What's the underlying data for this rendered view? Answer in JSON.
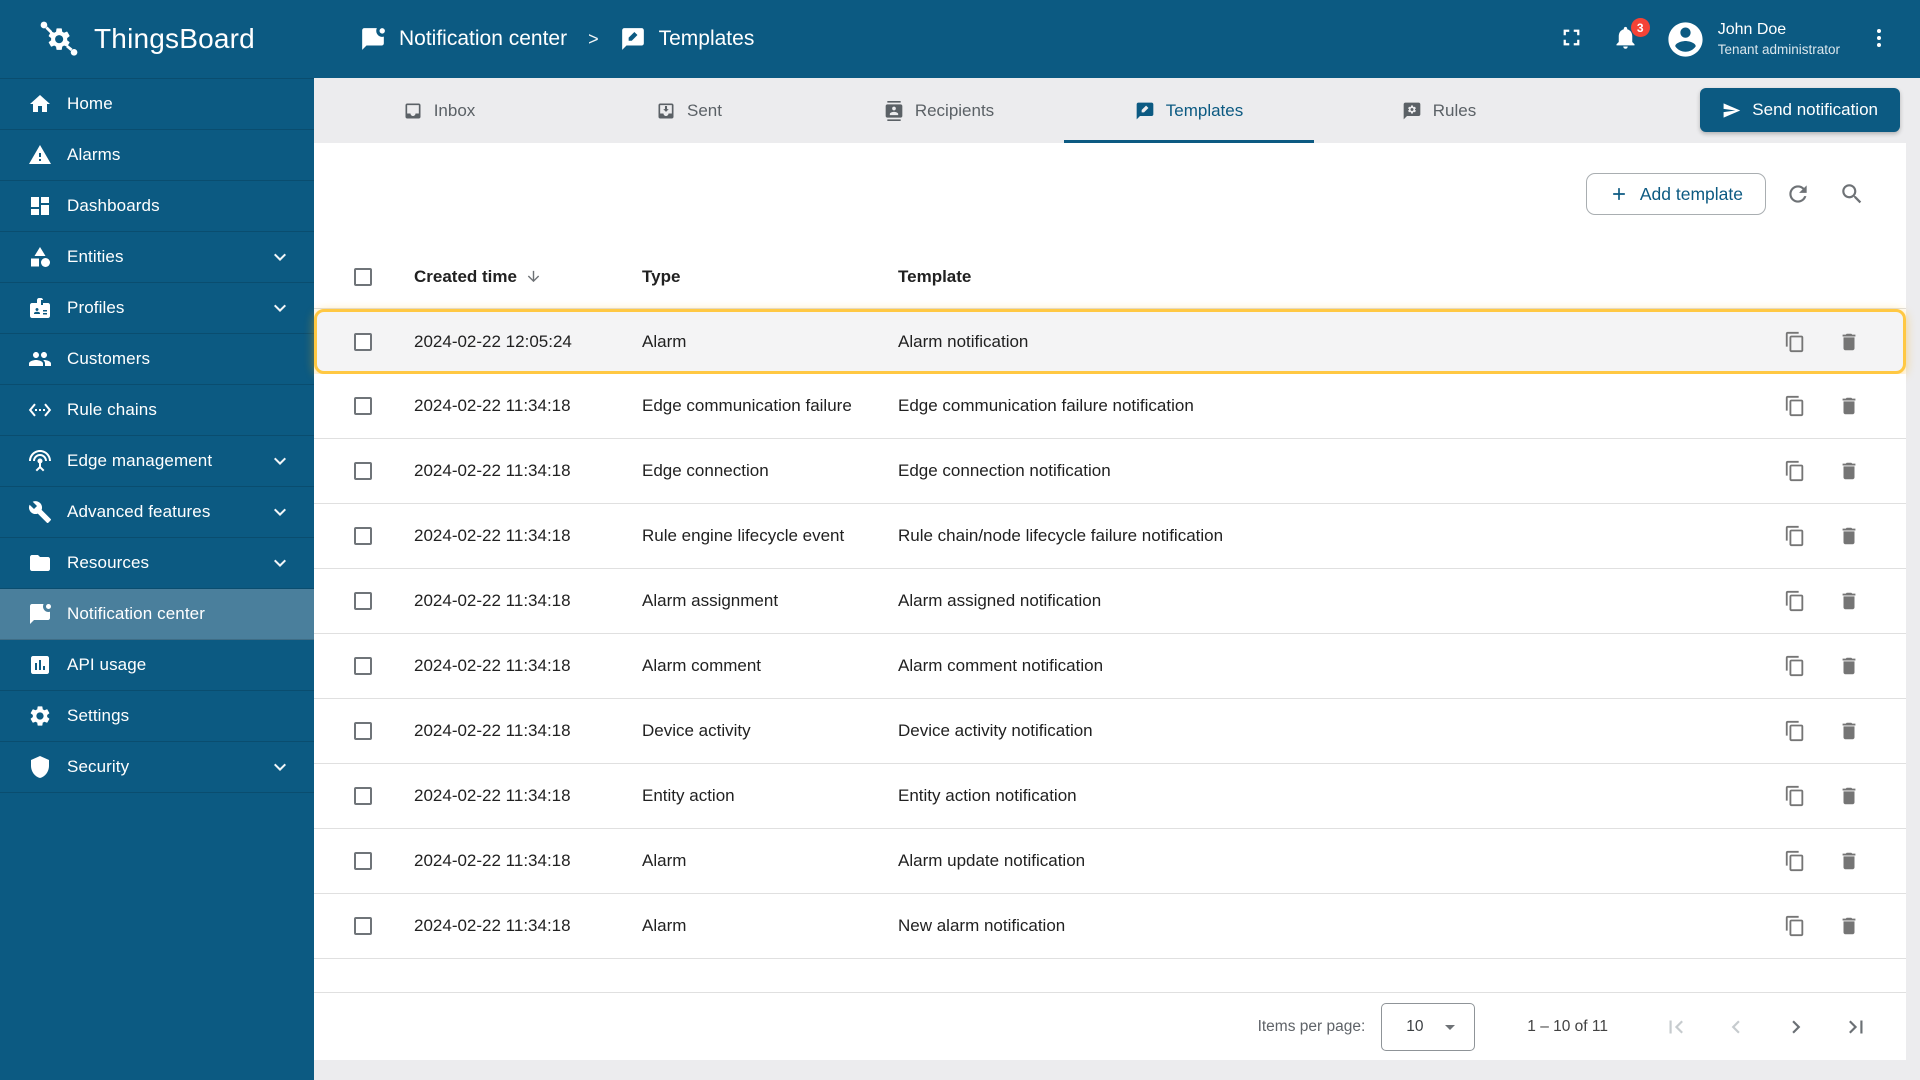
{
  "app": {
    "name": "ThingsBoard"
  },
  "topbar": {
    "breadcrumb": [
      {
        "label": "Notification center",
        "icon": "notification-center-icon"
      },
      {
        "label": "Templates",
        "icon": "templates-icon"
      }
    ],
    "separator": ">",
    "notifications_count": "3",
    "user": {
      "name": "John Doe",
      "role": "Tenant administrator"
    }
  },
  "sidebar": {
    "items": [
      {
        "label": "Home",
        "icon": "home-icon"
      },
      {
        "label": "Alarms",
        "icon": "alarms-icon"
      },
      {
        "label": "Dashboards",
        "icon": "dashboards-icon"
      },
      {
        "label": "Entities",
        "icon": "entities-icon",
        "expandable": true
      },
      {
        "label": "Profiles",
        "icon": "profiles-icon",
        "expandable": true
      },
      {
        "label": "Customers",
        "icon": "customers-icon"
      },
      {
        "label": "Rule chains",
        "icon": "rule-chains-icon"
      },
      {
        "label": "Edge management",
        "icon": "edge-management-icon",
        "expandable": true
      },
      {
        "label": "Advanced features",
        "icon": "advanced-features-icon",
        "expandable": true
      },
      {
        "label": "Resources",
        "icon": "resources-icon",
        "expandable": true
      },
      {
        "label": "Notification center",
        "icon": "notification-center-icon",
        "active": true
      },
      {
        "label": "API usage",
        "icon": "api-usage-icon"
      },
      {
        "label": "Settings",
        "icon": "settings-icon"
      },
      {
        "label": "Security",
        "icon": "security-icon",
        "expandable": true
      }
    ]
  },
  "tabs": {
    "items": [
      {
        "label": "Inbox",
        "icon": "inbox-icon"
      },
      {
        "label": "Sent",
        "icon": "sent-icon"
      },
      {
        "label": "Recipients",
        "icon": "recipients-icon"
      },
      {
        "label": "Templates",
        "icon": "templates-icon",
        "active": true
      },
      {
        "label": "Rules",
        "icon": "rules-icon"
      }
    ],
    "send_button_label": "Send notification"
  },
  "toolbar": {
    "add_button_label": "Add template"
  },
  "table": {
    "columns": {
      "created": "Created time",
      "type": "Type",
      "template": "Template"
    },
    "rows": [
      {
        "created": "2024-02-22 12:05:24",
        "type": "Alarm",
        "template": "Alarm notification",
        "highlighted": true
      },
      {
        "created": "2024-02-22 11:34:18",
        "type": "Edge communication failure",
        "template": "Edge communication failure notification"
      },
      {
        "created": "2024-02-22 11:34:18",
        "type": "Edge connection",
        "template": "Edge connection notification"
      },
      {
        "created": "2024-02-22 11:34:18",
        "type": "Rule engine lifecycle event",
        "template": "Rule chain/node lifecycle failure notification"
      },
      {
        "created": "2024-02-22 11:34:18",
        "type": "Alarm assignment",
        "template": "Alarm assigned notification"
      },
      {
        "created": "2024-02-22 11:34:18",
        "type": "Alarm comment",
        "template": "Alarm comment notification"
      },
      {
        "created": "2024-02-22 11:34:18",
        "type": "Device activity",
        "template": "Device activity notification"
      },
      {
        "created": "2024-02-22 11:34:18",
        "type": "Entity action",
        "template": "Entity action notification"
      },
      {
        "created": "2024-02-22 11:34:18",
        "type": "Alarm",
        "template": "Alarm update notification"
      },
      {
        "created": "2024-02-22 11:34:18",
        "type": "Alarm",
        "template": "New alarm notification"
      }
    ]
  },
  "pagination": {
    "items_per_page_label": "Items per page:",
    "items_per_page_value": "10",
    "range": "1 – 10 of 11"
  },
  "colors": {
    "primary": "#0c5a82",
    "sidebar_active": "#4a7f9c",
    "highlight": "#ffc843",
    "badge": "#f44336"
  }
}
